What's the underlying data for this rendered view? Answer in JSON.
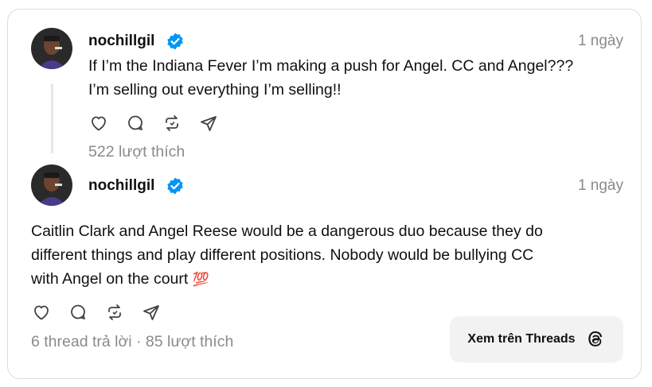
{
  "post1": {
    "username": "nochillgil",
    "time": "1 ngày",
    "text_line1": "If I’m the Indiana Fever I’m making a push for Angel. CC and Angel???",
    "text_line2": "I’m selling out everything I’m selling!!",
    "likes": "522 lượt thích"
  },
  "post2": {
    "username": "nochillgil",
    "time": "1 ngày",
    "text_line1": "Caitlin Clark and Angel Reese would be a dangerous duo because they do",
    "text_line2": "different things and play different positions. Nobody would be bullying CC",
    "text_line3": "with Angel on the court",
    "emoji": "💯",
    "meta": "6 thread trả lời · 85 lượt thích"
  },
  "view_button": {
    "label": "Xem trên Threads"
  },
  "colors": {
    "verified": "#0095f6",
    "muted": "#8a8a8a",
    "text": "#101010"
  },
  "icons": [
    "heart-icon",
    "comment-icon",
    "repost-icon",
    "share-icon",
    "threads-logo-icon",
    "verified-badge-icon"
  ]
}
